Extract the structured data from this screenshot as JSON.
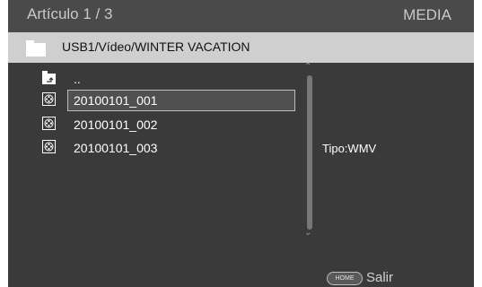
{
  "header": {
    "counter": "Artículo 1 / 3",
    "section": "MEDIA"
  },
  "path": {
    "icon": "folder-icon",
    "text": "USB1/Vídeo/WINTER VACATION"
  },
  "list": {
    "items": [
      {
        "icon": "folder-up-icon",
        "label": "..",
        "selected": false
      },
      {
        "icon": "video-file-icon",
        "label": "20100101_001",
        "selected": true
      },
      {
        "icon": "video-file-icon",
        "label": "20100101_002",
        "selected": false
      },
      {
        "icon": "video-file-icon",
        "label": "20100101_003",
        "selected": false
      }
    ]
  },
  "info": {
    "type": "Tipo:WMV"
  },
  "footer": {
    "home_key": "HOME",
    "exit_label": "Salir"
  }
}
